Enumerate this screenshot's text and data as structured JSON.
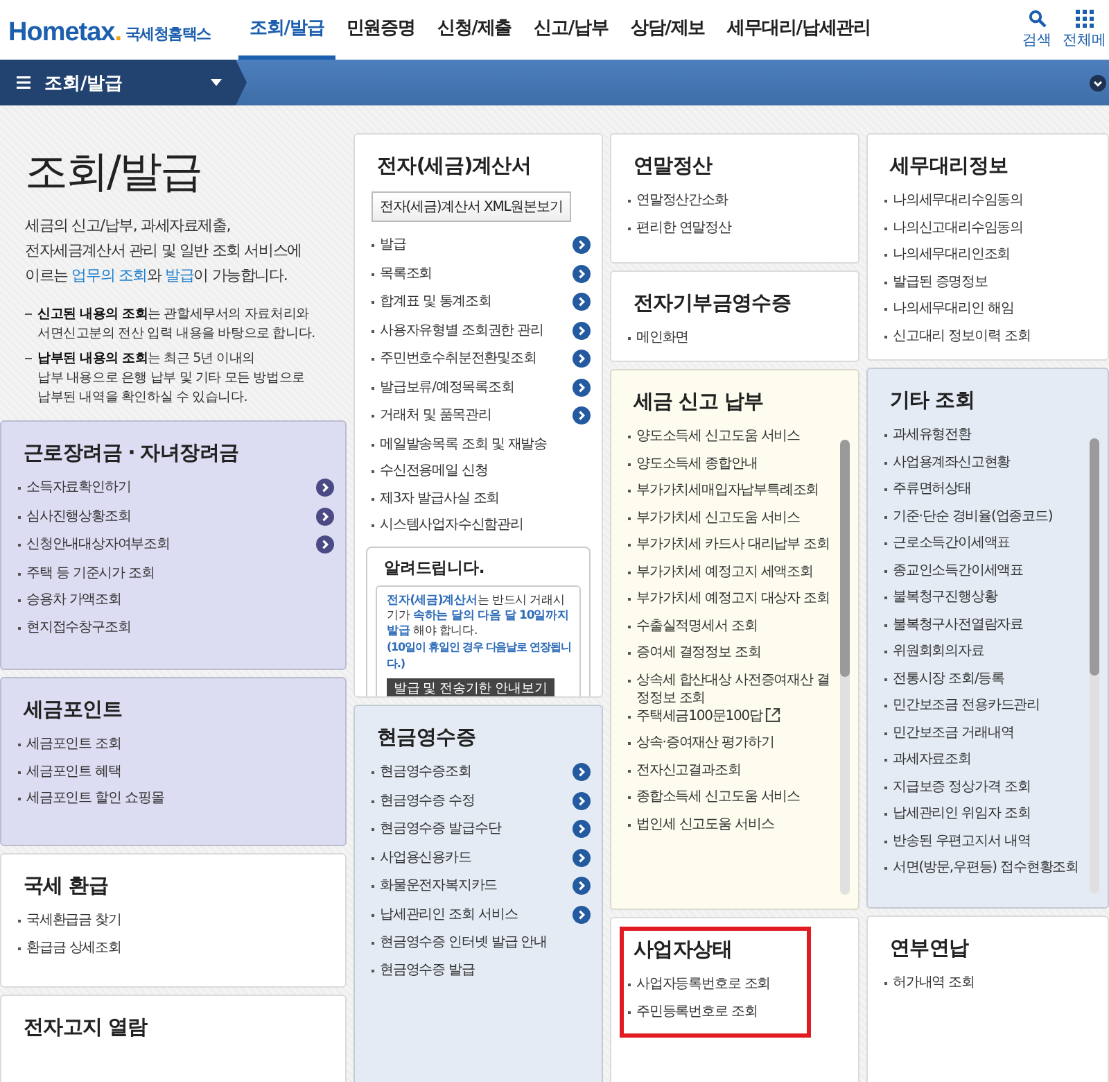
{
  "header": {
    "logo": "Hometax",
    "logo_dot": ".",
    "agency": "국세청홈택스",
    "nav": [
      {
        "label": "조회/발급",
        "selected": true
      },
      {
        "label": "민원증명",
        "selected": false
      },
      {
        "label": "신청/제출",
        "selected": false
      },
      {
        "label": "신고/납부",
        "selected": false
      },
      {
        "label": "상담/제보",
        "selected": false
      },
      {
        "label": "세무대리/납세관리",
        "selected": false
      }
    ],
    "tools": [
      {
        "kind": "search",
        "label": "검색"
      },
      {
        "kind": "menu",
        "label": "전체메"
      }
    ]
  },
  "menu_bar": {
    "label": "조회/발급"
  },
  "intro": {
    "title": "조회/발급",
    "description": [
      {
        "text": "세금의 신고/납부, 과세자료제출,\n전자세금계산서 관리 및 일반 조회 서비스에\n이르는 ",
        "link": false
      },
      {
        "text": "업무의 조회",
        "link": true
      },
      {
        "text": "와 ",
        "link": false
      },
      {
        "text": "발급",
        "link": true
      },
      {
        "text": "이 가능합니다.",
        "link": false
      }
    ],
    "notes": [
      "**신고된 내용의 조회**는 관할세무서의 자료처리와\n서면신고분의 전산 입력 내용을 바탕으로 합니다.",
      "**납부된 내용의 조회**는 최근 5년 이내의\n납부 내용으로 은행 납부 및 기타 모든 방법으로\n납부된 내역을 확인하실 수 있습니다."
    ]
  },
  "columns": [
    {
      "cards": [
        {
          "title": "근로장려금 · 자녀장려금",
          "color": "#dcdcf2",
          "highlighted": false,
          "scrollable": false,
          "items": [
            {
              "label": "소득자료확인하기",
              "arrow": true
            },
            {
              "label": "심사진행상황조회",
              "arrow": true
            },
            {
              "label": "신청안내대상자여부조회",
              "arrow": true
            },
            {
              "label": "주택 등 기준시가 조회",
              "arrow": false
            },
            {
              "label": "승용차 가액조회",
              "arrow": false
            },
            {
              "label": "현지접수창구조회",
              "arrow": false
            }
          ]
        },
        {
          "title": "세금포인트",
          "color": "#dcdcf2",
          "highlighted": false,
          "scrollable": false,
          "items": [
            {
              "label": "세금포인트 조회",
              "arrow": false
            },
            {
              "label": "세금포인트 혜택",
              "arrow": false
            },
            {
              "label": "세금포인트 할인 쇼핑몰",
              "arrow": false
            }
          ]
        },
        {
          "title": "국세 환급",
          "color": "#ffffff",
          "highlighted": false,
          "scrollable": false,
          "items": [
            {
              "label": "국세환급금 찾기",
              "arrow": false
            },
            {
              "label": "환급금 상세조회",
              "arrow": false
            }
          ]
        },
        {
          "title": "전자고지 열람",
          "color": "#ffffff",
          "highlighted": false,
          "scrollable": false
        }
      ]
    },
    {
      "cards": [
        {
          "title": "전자(세금)계산서",
          "color": "#ffffff",
          "highlighted": false,
          "scrollable": false,
          "button": "전자(세금)계산서 XML원본보기",
          "items": [
            {
              "label": "발급",
              "arrow": true
            },
            {
              "label": "목록조회",
              "arrow": true
            },
            {
              "label": "합계표 및 통계조회",
              "arrow": true
            },
            {
              "label": "사용자유형별 조회권한 관리",
              "arrow": true
            },
            {
              "label": "주민번호수취분전환및조회",
              "arrow": true
            },
            {
              "label": "발급보류/예정목록조회",
              "arrow": true
            },
            {
              "label": "거래처 및 품목관리",
              "arrow": true
            },
            {
              "label": "메일발송목록 조회 및 재발송",
              "arrow": false
            },
            {
              "label": "수신전용메일 신청",
              "arrow": false
            },
            {
              "label": "제3자 발급사실 조회",
              "arrow": false
            },
            {
              "label": "시스템사업자수신함관리",
              "arrow": false
            }
          ],
          "notice": {
            "title": "알려드립니다.",
            "text": "**전자(세금)계산서**는 반드시 거래시기가 **속하는 달의 다음 달 10일까지 발급** 해야 합니다.",
            "sub": "(10일이 휴일인 경우 다음날로 연장됩니다.)",
            "button": "발급 및 전송기한 안내보기"
          }
        },
        {
          "title": "현금영수증",
          "color": "#e4ebf4",
          "highlighted": false,
          "scrollable": false,
          "items": [
            {
              "label": "현금영수증조회",
              "arrow": true
            },
            {
              "label": "현금영수증 수정",
              "arrow": true
            },
            {
              "label": "현금영수증 발급수단",
              "arrow": true
            },
            {
              "label": "사업용신용카드",
              "arrow": true
            },
            {
              "label": "화물운전자복지카드",
              "arrow": true
            },
            {
              "label": "납세관리인 조회 서비스",
              "arrow": true
            },
            {
              "label": "현금영수증 인터넷 발급 안내",
              "arrow": false
            },
            {
              "label": "현금영수증 발급",
              "arrow": false
            }
          ]
        }
      ]
    },
    {
      "cards": [
        {
          "title": "연말정산",
          "color": "#ffffff",
          "highlighted": false,
          "scrollable": false,
          "items": [
            {
              "label": "연말정산간소화",
              "arrow": false
            },
            {
              "label": "편리한 연말정산",
              "arrow": false
            }
          ]
        },
        {
          "title": "전자기부금영수증",
          "color": "#ffffff",
          "highlighted": false,
          "scrollable": false,
          "items": [
            {
              "label": "메인화면",
              "arrow": false
            }
          ]
        },
        {
          "title": "세금 신고 납부",
          "color": "#fdfcee",
          "highlighted": false,
          "scrollable": true,
          "items": [
            {
              "label": "양도소득세 신고도움 서비스",
              "arrow": false
            },
            {
              "label": "양도소득세 종합안내",
              "arrow": false
            },
            {
              "label": "부가가치세매입자납부특례조회",
              "arrow": false
            },
            {
              "label": "부가가치세 신고도움 서비스",
              "arrow": false
            },
            {
              "label": "부가가치세 카드사 대리납부 조회",
              "arrow": false
            },
            {
              "label": "부가가치세 예정고지 세액조회",
              "arrow": false
            },
            {
              "label": "부가가치세 예정고지 대상자 조회",
              "arrow": false
            },
            {
              "label": "수출실적명세서 조회",
              "arrow": false
            },
            {
              "label": "증여세 결정정보 조회",
              "arrow": false
            },
            {
              "label": "상속세 합산대상 사전증여재산 결정정보 조회",
              "arrow": false
            },
            {
              "label": "주택세금100문100답",
              "arrow": false,
              "external": true
            },
            {
              "label": "상속·증여재산 평가하기",
              "arrow": false
            },
            {
              "label": "전자신고결과조회",
              "arrow": false
            },
            {
              "label": "종합소득세 신고도움 서비스",
              "arrow": false
            },
            {
              "label": "법인세 신고도움 서비스",
              "arrow": false
            }
          ]
        },
        {
          "title": "사업자상태",
          "color": "#ffffff",
          "highlighted": true,
          "scrollable": false,
          "items": [
            {
              "label": "사업자등록번호로 조회",
              "arrow": false
            },
            {
              "label": "주민등록번호로 조회",
              "arrow": false
            }
          ]
        }
      ]
    },
    {
      "cards": [
        {
          "title": "세무대리정보",
          "color": "#ffffff",
          "highlighted": false,
          "scrollable": false,
          "items": [
            {
              "label": "나의세무대리수임동의",
              "arrow": false
            },
            {
              "label": "나의신고대리수임동의",
              "arrow": false
            },
            {
              "label": "나의세무대리인조회",
              "arrow": false
            },
            {
              "label": "발급된 증명정보",
              "arrow": false
            },
            {
              "label": "나의세무대리인 해임",
              "arrow": false
            },
            {
              "label": "신고대리 정보이력 조회",
              "arrow": false
            }
          ]
        },
        {
          "title": "기타 조회",
          "color": "#e4ebf4",
          "highlighted": false,
          "scrollable": true,
          "items": [
            {
              "label": "과세유형전환",
              "arrow": false
            },
            {
              "label": "사업용계좌신고현황",
              "arrow": false
            },
            {
              "label": "주류면허상태",
              "arrow": false
            },
            {
              "label": "기준·단순 경비율(업종코드)",
              "arrow": false
            },
            {
              "label": "근로소득간이세액표",
              "arrow": false
            },
            {
              "label": "종교인소득간이세액표",
              "arrow": false
            },
            {
              "label": "불복청구진행상황",
              "arrow": false
            },
            {
              "label": "불복청구사전열람자료",
              "arrow": false
            },
            {
              "label": "위원회회의자료",
              "arrow": false
            },
            {
              "label": "전통시장 조회/등록",
              "arrow": false
            },
            {
              "label": "민간보조금 전용카드관리",
              "arrow": false
            },
            {
              "label": "민간보조금 거래내역",
              "arrow": false
            },
            {
              "label": "과세자료조회",
              "arrow": false
            },
            {
              "label": "지급보증 정상가격 조회",
              "arrow": false
            },
            {
              "label": "납세관리인 위임자 조회",
              "arrow": false
            },
            {
              "label": "반송된 우편고지서 내역",
              "arrow": false
            },
            {
              "label": "서면(방문,우편등) 접수현황조회",
              "arrow": false
            }
          ]
        },
        {
          "title": "연부연납",
          "color": "#ffffff",
          "highlighted": false,
          "scrollable": false,
          "items": [
            {
              "label": "허가내역 조회",
              "arrow": false
            }
          ]
        }
      ]
    }
  ]
}
